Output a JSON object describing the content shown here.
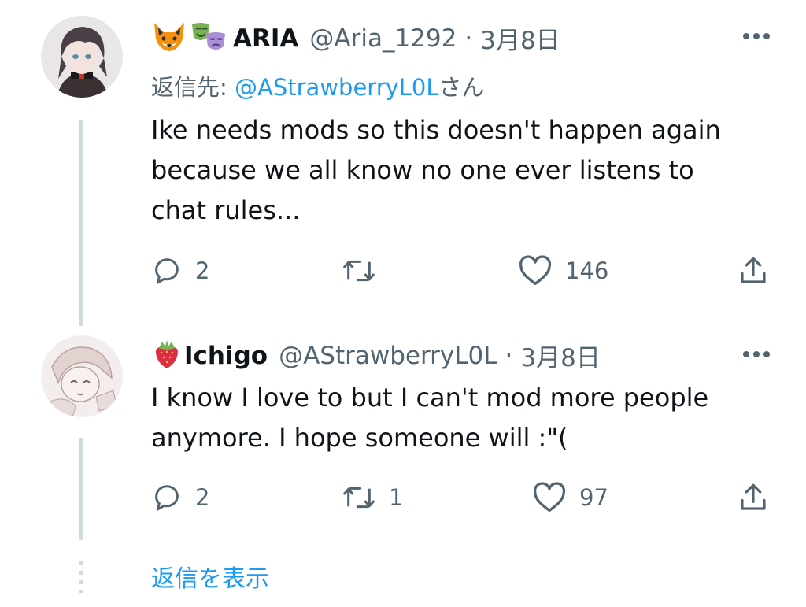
{
  "tweets": [
    {
      "name": "ARIA",
      "handle": "@Aria_1292",
      "separator": "·",
      "date": "3月8日",
      "replying_prefix": "返信先: ",
      "replying_to": "@AStrawberryL0L",
      "replying_suffix": "さん",
      "text": "Ike needs mods so this doesn't happen again\nbecause we all know no one ever listens to\nchat rules...",
      "name_emojis": [
        "fox-emoji",
        "performing-arts-emoji"
      ],
      "actions": {
        "reply": "2",
        "retweet": "",
        "like": "146"
      }
    },
    {
      "name": "Ichigo",
      "handle": "@AStrawberryL0L",
      "separator": "·",
      "date": "3月8日",
      "text": "I know I love to but I can't mod more people\nanymore. I hope someone will :\"(",
      "name_emojis": [
        "strawberry-emoji"
      ],
      "actions": {
        "reply": "2",
        "retweet": "1",
        "like": "97"
      }
    }
  ],
  "show_replies": "返信を表示",
  "colors": {
    "accent": "#1d9bf0",
    "secondary_text": "#536471",
    "thread_line": "#cfd9de"
  }
}
